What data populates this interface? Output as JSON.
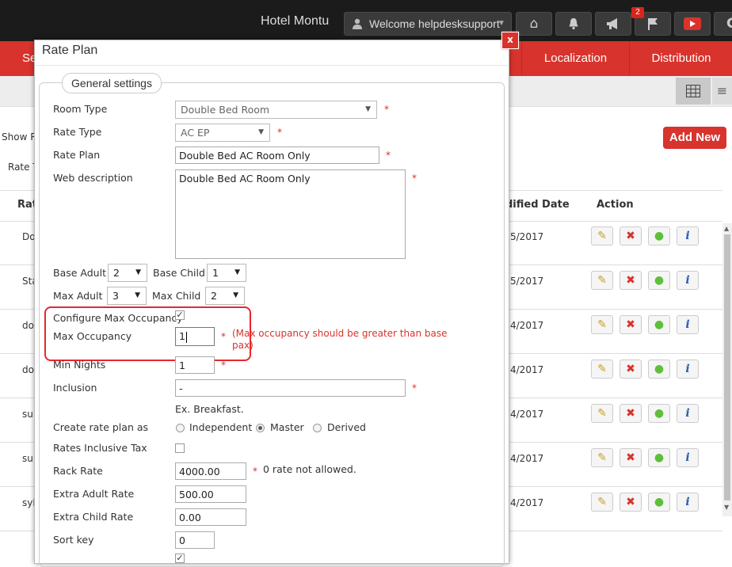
{
  "topbar": {
    "hotel_name": "Hotel Montu",
    "welcome": "Welcome helpdesksupport",
    "notification_count": "2",
    "icons": [
      "home-icon",
      "bell-icon",
      "megaphone-icon",
      "flag-icon",
      "youtube-icon",
      "google-icon"
    ]
  },
  "nav": {
    "items": [
      {
        "label": "Se"
      },
      {
        "label": "Localization"
      },
      {
        "label": "Distribution"
      }
    ]
  },
  "page": {
    "filter_label": "Show R",
    "rate_type_label": "Rate T",
    "add_new": "Add New",
    "columns": {
      "name": "Rat",
      "modified": "dified Date",
      "action": "Action"
    },
    "rows": [
      {
        "name": "Do",
        "date": "5/2017"
      },
      {
        "name": "Sta",
        "date": "5/2017"
      },
      {
        "name": "do",
        "date": "4/2017"
      },
      {
        "name": "do",
        "date": "4/2017"
      },
      {
        "name": "sui",
        "date": "4/2017"
      },
      {
        "name": "sui",
        "date": "4/2017"
      },
      {
        "name": "syl",
        "date": "4/2017"
      }
    ]
  },
  "modal": {
    "title": "Rate Plan",
    "close": "x",
    "legend": "General settings",
    "required_mark": "*",
    "room_type": {
      "label": "Room Type",
      "value": "Double Bed Room"
    },
    "rate_type": {
      "label": "Rate Type",
      "value": "AC EP"
    },
    "rate_plan": {
      "label": "Rate Plan",
      "value": "Double Bed AC Room Only"
    },
    "web_description": {
      "label": "Web description",
      "value": "Double Bed AC Room Only"
    },
    "base_adult": {
      "label": "Base Adult",
      "value": "2"
    },
    "base_child": {
      "label": "Base Child",
      "value": "1"
    },
    "max_adult": {
      "label": "Max Adult",
      "value": "3"
    },
    "max_child": {
      "label": "Max Child",
      "value": "2"
    },
    "configure_max_occupancy": {
      "label": "Configure Max Occupancy",
      "checked": true
    },
    "max_occupancy": {
      "label": "Max Occupancy",
      "value": "1",
      "error_line1": "(Max occupancy should be greater than base",
      "error_line2": "pax)"
    },
    "min_nights": {
      "label": "Min Nights",
      "value": "1"
    },
    "inclusion": {
      "label": "Inclusion",
      "value": "-",
      "hint": "Ex. Breakfast."
    },
    "create_rate_plan_as": {
      "label": "Create rate plan as",
      "options": [
        "Independent",
        "Master",
        "Derived"
      ],
      "selected": "Master"
    },
    "rates_inclusive_tax": {
      "label": "Rates Inclusive Tax",
      "checked": false
    },
    "rack_rate": {
      "label": "Rack Rate",
      "value": "4000.00",
      "note": "0 rate not allowed."
    },
    "extra_adult_rate": {
      "label": "Extra Adult Rate",
      "value": "500.00"
    },
    "extra_child_rate": {
      "label": "Extra Child Rate",
      "value": "0.00"
    },
    "sort_key": {
      "label": "Sort key",
      "value": "0"
    }
  }
}
